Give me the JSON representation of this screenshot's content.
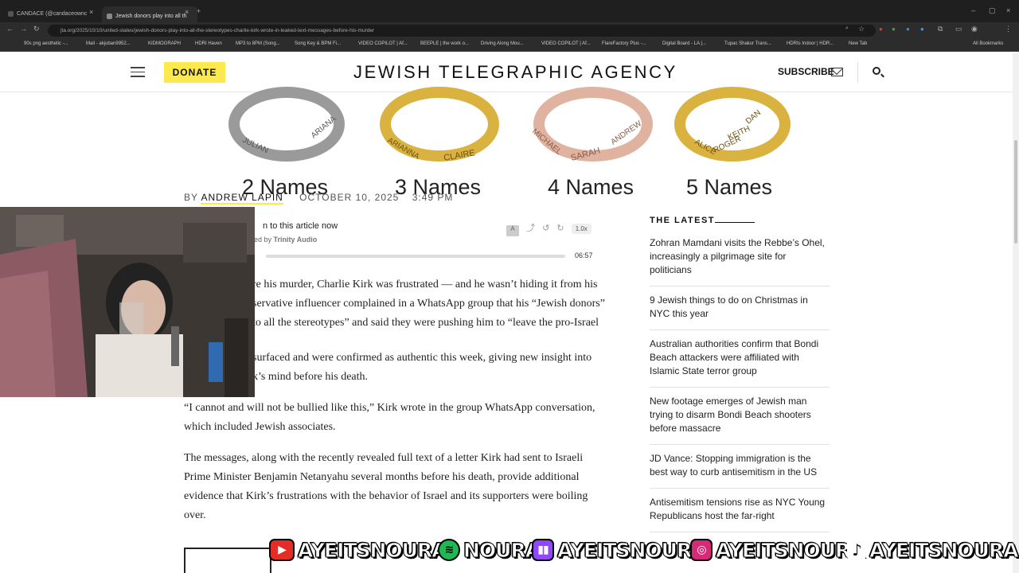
{
  "browser": {
    "tabs": [
      {
        "label": "CANDACE (@candaceownc"
      },
      {
        "label": "Jewish donors play into all th"
      }
    ],
    "url": "jta.org/2025/10/10/united-states/jewish-donors-play-into-all-the-stereotypes-charlie-kirk-wrote-in-leaked-text-messages-before-his-murder",
    "bookmarks": [
      "90s png aesthetic -...",
      "Mail - akjuban9952...",
      "KIDMOGRAPH",
      "HDRI Haven",
      "MP3 to 8PM (Song...",
      "Song Key & BPM Fi...",
      "VIDEO COPILOT | Af...",
      "BEEPLE | the work o...",
      "Driving Along Mou...",
      "VIDEO COPILOT | Af...",
      "FlareFactory Plus -...",
      "Digital Board - LA |...",
      "Tupac Shakur Trans...",
      "HDRIs Indoor | HDR...",
      "New Tab"
    ],
    "all_bookmarks": "All Bookmarks"
  },
  "header": {
    "donate": "DONATE",
    "logo": "JEWISH TELEGRAPHIC AGENCY",
    "subscribe": "SUBSCRIBE"
  },
  "ad": {
    "names": [
      "2 Names",
      "3 Names",
      "4 Names",
      "5 Names"
    ],
    "ring_text": [
      "JULIAN",
      "ARIANA",
      "ARIANNA",
      "CLAIRE",
      "MICHAEL",
      "SARAH",
      "ANDREW",
      "ALICE",
      "ROGER",
      "KEITH",
      "DAN"
    ]
  },
  "byline": {
    "by": "BY",
    "author": "ANDREW LAPIN",
    "date": "OCTOBER 10, 2025",
    "time": "3:49 PM"
  },
  "audio": {
    "title": "n to this article now",
    "powered_prefix": "red by",
    "powered": "Trinity Audio",
    "speed": "1.0x",
    "duration": "06:57"
  },
  "article": {
    "paragraphs": [
      "re his murder, Charlie Kirk was frustrated — and he wasn’t hiding it from his servative influencer complained in a WhatsApp group that his “Jewish donors” to all the stereotypes” and said they were pushing him to “leave the pro-Israel",
      "surfaced and were confirmed as authentic this week, giving new insight into k’s mind before his death.",
      "“I cannot and will not be bullied like this,” Kirk wrote in the group WhatsApp conversation, which included Jewish associates.",
      "The messages, along with the recently revealed full text of a letter Kirk had sent to Israeli Prime Minister Benjamin Netanyahu several months before his death, provide additional evidence that Kirk’s frustrations with the behavior of Israel and its supporters were boiling over."
    ]
  },
  "latest": {
    "heading": "THE LATEST",
    "items": [
      "Zohran Mamdani visits the Rebbe’s Ohel, increasingly a pilgrimage site for politicians",
      "9 Jewish things to do on Christmas in NYC this year",
      "Australian authorities confirm that Bondi Beach attackers were affiliated with Islamic State terror group",
      "New footage emerges of Jewish man trying to disarm Bondi Beach shooters before massacre",
      "JD Vance: Stopping immigration is the best way to curb antisemitism in the US",
      "Antisemitism tensions rise as NYC Young Republicans host the far-right"
    ]
  },
  "banner": {
    "items": [
      {
        "icon": "youtube-icon",
        "label": "AYEITSNOURA",
        "color": "#e52d27"
      },
      {
        "icon": "spotify-icon",
        "label": "NOURA",
        "color": "#1db954"
      },
      {
        "icon": "twitch-icon",
        "label": "AYEITSNOURA",
        "color": "#9146ff"
      },
      {
        "icon": "instagram-icon",
        "label": "AYEITSNOURA",
        "color": "#d62976"
      },
      {
        "icon": "tiktok-icon",
        "label": "AYEITSNOURA",
        "color": "#111111"
      }
    ]
  },
  "colors": {
    "accent": "#fbe94d",
    "text": "#222222"
  }
}
